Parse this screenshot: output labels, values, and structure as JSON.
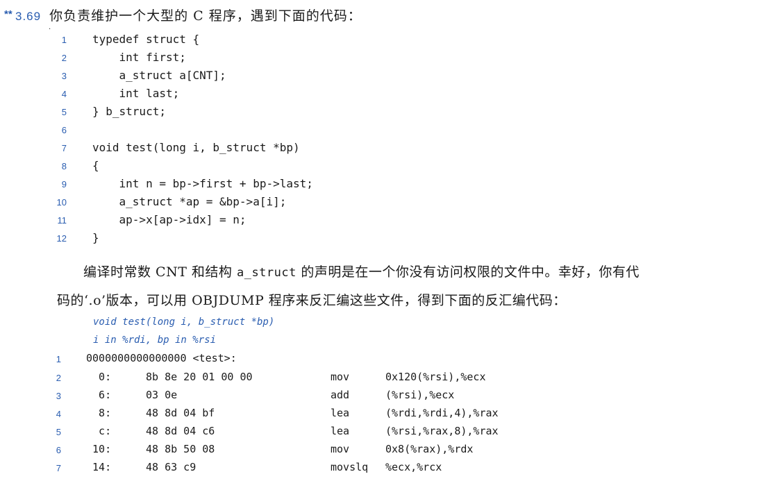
{
  "problem": {
    "difficulty_mark": "**",
    "number": "3.69",
    "title": "你负责维护一个大型的 C 程序，遇到下面的代码：",
    "dot": "."
  },
  "c_code": [
    {
      "n": "1",
      "text": "typedef struct {"
    },
    {
      "n": "2",
      "text": "    int first;"
    },
    {
      "n": "3",
      "text": "    a_struct a[CNT];"
    },
    {
      "n": "4",
      "text": "    int last;"
    },
    {
      "n": "5",
      "text": "} b_struct;"
    },
    {
      "n": "6",
      "text": ""
    },
    {
      "n": "7",
      "text": "void test(long i, b_struct *bp)"
    },
    {
      "n": "8",
      "text": "{"
    },
    {
      "n": "9",
      "text": "    int n = bp->first + bp->last;"
    },
    {
      "n": "10",
      "text": "    a_struct *ap = &bp->a[i];"
    },
    {
      "n": "11",
      "text": "    ap->x[ap->idx] = n;"
    },
    {
      "n": "12",
      "text": "}"
    }
  ],
  "paragraph": {
    "p1_a": "编译时常数 CNT 和结构 ",
    "p1_code": "a_struct",
    "p1_b": " 的声明是在一个你没有访问权限的文件中。幸好，你有代",
    "p2": "码的‘.o’版本，可以用 OBJDUMP 程序来反汇编这些文件，得到下面的反汇编代码："
  },
  "asm_header": [
    "void test(long i, b_struct *bp)",
    "i in %rdi, bp in %rsi"
  ],
  "asm_code": [
    {
      "n": "1",
      "addr": "0000000000000000 <test>:",
      "bytes": "",
      "op": "",
      "args": ""
    },
    {
      "n": "2",
      "addr": "  0:",
      "bytes": "8b 8e 20 01 00 00",
      "op": "mov",
      "args": "0x120(%rsi),%ecx"
    },
    {
      "n": "3",
      "addr": "  6:",
      "bytes": "03 0e",
      "op": "add",
      "args": "(%rsi),%ecx"
    },
    {
      "n": "4",
      "addr": "  8:",
      "bytes": "48 8d 04 bf",
      "op": "lea",
      "args": "(%rdi,%rdi,4),%rax"
    },
    {
      "n": "5",
      "addr": "  c:",
      "bytes": "48 8d 04 c6",
      "op": "lea",
      "args": "(%rsi,%rax,8),%rax"
    },
    {
      "n": "6",
      "addr": " 10:",
      "bytes": "48 8b 50 08",
      "op": "mov",
      "args": "0x8(%rax),%rdx"
    },
    {
      "n": "7",
      "addr": " 14:",
      "bytes": "48 63 c9",
      "op": "movslq",
      "args": "%ecx,%rcx"
    }
  ]
}
